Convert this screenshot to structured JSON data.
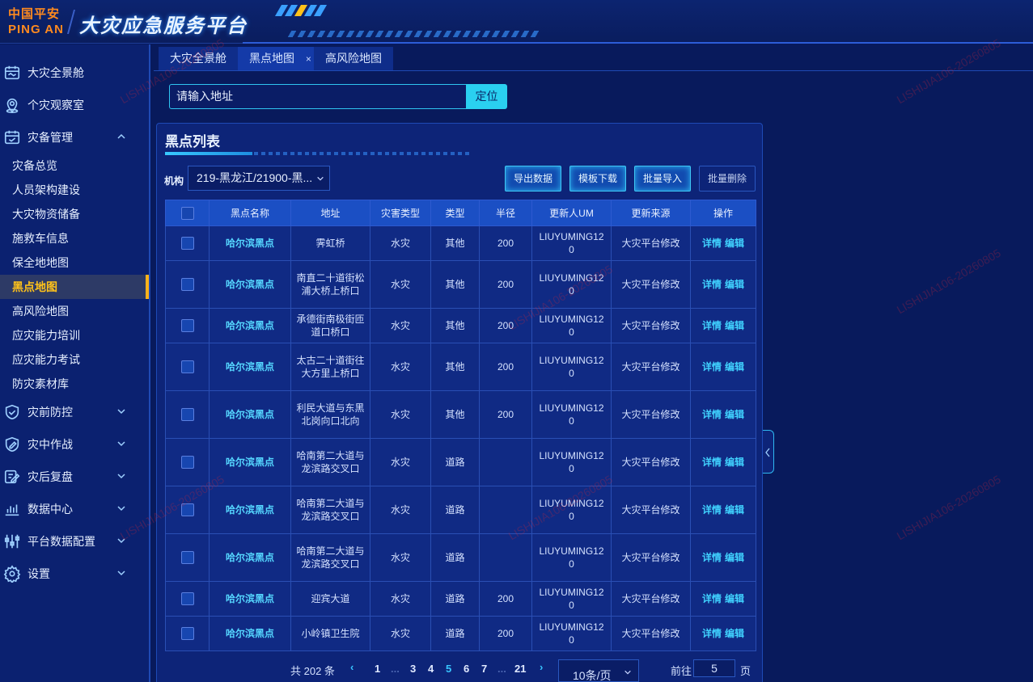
{
  "header": {
    "logo_line1": "中国平安",
    "logo_line2": "PING AN",
    "platform_title": "大灾应急服务平台"
  },
  "sidebar": {
    "items": [
      {
        "label": "大灾全景舱",
        "icon": "calendar-map-icon"
      },
      {
        "label": "个灾观察室",
        "icon": "location-pin-icon"
      },
      {
        "label": "灾备管理",
        "icon": "calendar-check-icon",
        "expanded": true
      },
      {
        "label": "灾前防控",
        "icon": "shield-check-icon"
      },
      {
        "label": "灾中作战",
        "icon": "pencil-shield-icon"
      },
      {
        "label": "灾后复盘",
        "icon": "edit-icon"
      },
      {
        "label": "数据中心",
        "icon": "bar-chart-icon"
      },
      {
        "label": "平台数据配置",
        "icon": "sliders-icon"
      },
      {
        "label": "设置",
        "icon": "gear-icon"
      }
    ],
    "sub_items": [
      {
        "label": "灾备总览"
      },
      {
        "label": "人员架构建设"
      },
      {
        "label": "大灾物资储备"
      },
      {
        "label": "施救车信息"
      },
      {
        "label": "保全地地图"
      },
      {
        "label": "黑点地图",
        "active": true
      },
      {
        "label": "高风险地图"
      },
      {
        "label": "应灾能力培训"
      },
      {
        "label": "应灾能力考试"
      },
      {
        "label": "防灾素材库"
      }
    ]
  },
  "tabs": [
    {
      "label": "大灾全景舱"
    },
    {
      "label": "黑点地图",
      "close": "×",
      "active": true
    },
    {
      "label": "高风险地图"
    }
  ],
  "search": {
    "value": "请输入地址",
    "button": "定位"
  },
  "panel": {
    "title": "黑点列表",
    "org_label": "机构",
    "org_value": "219-黑龙江/21900-黑...",
    "buttons": {
      "export": "导出数据",
      "template": "模板下载",
      "import": "批量导入",
      "delete": "批量删除"
    }
  },
  "table": {
    "headers": [
      "黑点名称",
      "地址",
      "灾害类型",
      "类型",
      "半径",
      "更新人UM",
      "更新来源",
      "操作"
    ],
    "rows": [
      {
        "name": "哈尔滨黑点",
        "address": "霁虹桥",
        "hazard": "水灾",
        "type": "其他",
        "radius": "200",
        "um": "LIUYUMING120",
        "source": "大灾平台修改"
      },
      {
        "name": "哈尔滨黑点",
        "address": "南直二十道街松浦大桥上桥口",
        "hazard": "水灾",
        "type": "其他",
        "radius": "200",
        "um": "LIUYUMING120",
        "source": "大灾平台修改"
      },
      {
        "name": "哈尔滨黑点",
        "address": "承德街南极街匝道口桥口",
        "hazard": "水灾",
        "type": "其他",
        "radius": "200",
        "um": "LIUYUMING120",
        "source": "大灾平台修改"
      },
      {
        "name": "哈尔滨黑点",
        "address": "太古二十道街往大方里上桥口",
        "hazard": "水灾",
        "type": "其他",
        "radius": "200",
        "um": "LIUYUMING120",
        "source": "大灾平台修改"
      },
      {
        "name": "哈尔滨黑点",
        "address": "利民大道与东黑北岗向口北向",
        "hazard": "水灾",
        "type": "其他",
        "radius": "200",
        "um": "LIUYUMING120",
        "source": "大灾平台修改"
      },
      {
        "name": "哈尔滨黑点",
        "address": "哈南第二大道与龙滨路交叉口",
        "hazard": "水灾",
        "type": "道路",
        "radius": "",
        "um": "LIUYUMING120",
        "source": "大灾平台修改"
      },
      {
        "name": "哈尔滨黑点",
        "address": "哈南第二大道与龙滨路交叉口",
        "hazard": "水灾",
        "type": "道路",
        "radius": "",
        "um": "LIUYUMING120",
        "source": "大灾平台修改"
      },
      {
        "name": "哈尔滨黑点",
        "address": "哈南第二大道与龙滨路交叉口",
        "hazard": "水灾",
        "type": "道路",
        "radius": "",
        "um": "LIUYUMING120",
        "source": "大灾平台修改"
      },
      {
        "name": "哈尔滨黑点",
        "address": "迎宾大道",
        "hazard": "水灾",
        "type": "道路",
        "radius": "200",
        "um": "LIUYUMING120",
        "source": "大灾平台修改"
      },
      {
        "name": "哈尔滨黑点",
        "address": "小岭镇卫生院",
        "hazard": "水灾",
        "type": "道路",
        "radius": "200",
        "um": "LIUYUMING120",
        "source": "大灾平台修改"
      }
    ],
    "op_detail": "详情",
    "op_edit": "编辑"
  },
  "pagination": {
    "total": "共 202 条",
    "pages": [
      "1",
      "...",
      "3",
      "4",
      "5",
      "6",
      "7",
      "...",
      "21"
    ],
    "current": "5",
    "page_size": "10条/页",
    "goto_label": "前往",
    "goto_value": "5",
    "goto_suffix": "页"
  },
  "watermark": "LISHIJIA106-20260805",
  "colors": {
    "background": "#081a5c",
    "accent": "#2ad0f0",
    "active_menu": "#ffc21a",
    "link": "#40d2ff"
  }
}
